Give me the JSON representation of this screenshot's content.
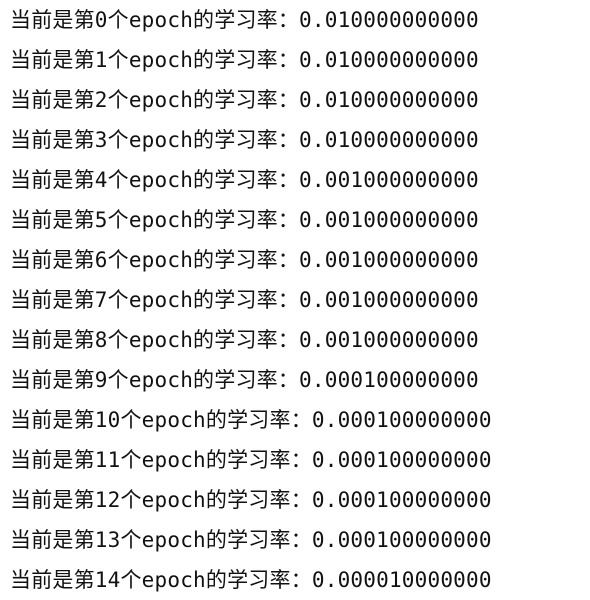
{
  "console": {
    "lines": [
      "当前是第0个epoch的学习率：0.010000000000",
      "当前是第1个epoch的学习率：0.010000000000",
      "当前是第2个epoch的学习率：0.010000000000",
      "当前是第3个epoch的学习率：0.010000000000",
      "当前是第4个epoch的学习率：0.001000000000",
      "当前是第5个epoch的学习率：0.001000000000",
      "当前是第6个epoch的学习率：0.001000000000",
      "当前是第7个epoch的学习率：0.001000000000",
      "当前是第8个epoch的学习率：0.001000000000",
      "当前是第9个epoch的学习率：0.000100000000",
      "当前是第10个epoch的学习率：0.000100000000",
      "当前是第11个epoch的学习率：0.000100000000",
      "当前是第12个epoch的学习率：0.000100000000",
      "当前是第13个epoch的学习率：0.000100000000",
      "当前是第14个epoch的学习率：0.000010000000"
    ]
  }
}
